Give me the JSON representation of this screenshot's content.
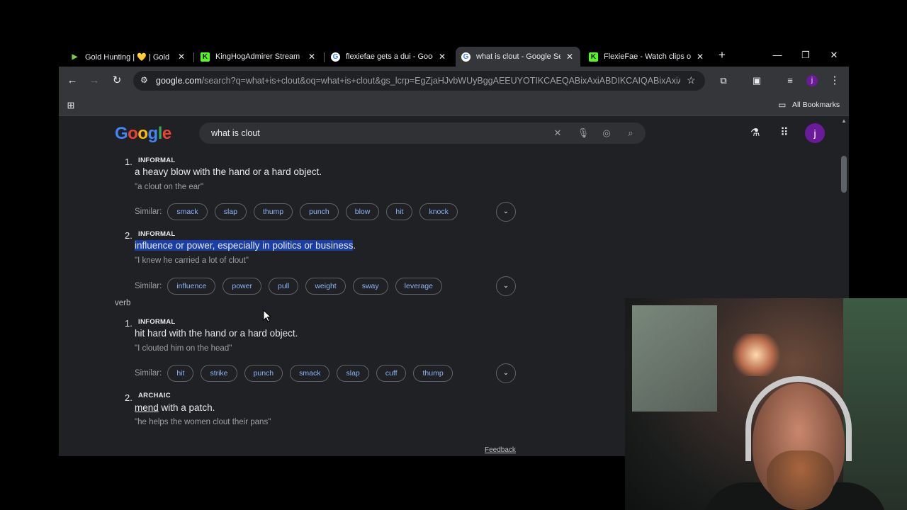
{
  "tabs": [
    {
      "title": "Gold Hunting | 💛 | Gold F",
      "favicon": "rumble-icon",
      "color": "#85c742"
    },
    {
      "title": "KingHogAdmirer Stream -",
      "favicon": "kick-icon",
      "color": "#53fc18"
    },
    {
      "title": "flexiefae gets a dui - Goog",
      "favicon": "google-icon",
      "color": "#ffffff"
    },
    {
      "title": "what is clout - Google Sea",
      "favicon": "google-icon",
      "color": "#ffffff"
    },
    {
      "title": "FlexieFae - Watch clips on",
      "favicon": "kick-icon",
      "color": "#53fc18"
    }
  ],
  "url": {
    "host": "google.com",
    "path": "/search?q=what+is+clout&oq=what+is+clout&gs_lcrp=EgZjaHJvbWUyBggAEEUYOTIKCAEQABixAxiABDIKCAIQABixAxiABDI..."
  },
  "bookmarks": {
    "all_label": "All Bookmarks"
  },
  "search": {
    "logo": "Google",
    "query": "what is clout",
    "avatar_letter": "j"
  },
  "definitions": {
    "noun": [
      {
        "num": "1.",
        "tag": "INFORMAL",
        "text": "a heavy blow with the hand or a hard object.",
        "example": "\"a clout on the ear\"",
        "similar_label": "Similar:",
        "similar": [
          "smack",
          "slap",
          "thump",
          "punch",
          "blow",
          "hit",
          "knock"
        ]
      },
      {
        "num": "2.",
        "tag": "INFORMAL",
        "text": "influence or power, especially in politics or business",
        "text_tail": ".",
        "example": "\"I knew he carried a lot of clout\"",
        "similar_label": "Similar:",
        "similar": [
          "influence",
          "power",
          "pull",
          "weight",
          "sway",
          "leverage"
        ]
      }
    ],
    "verb_label": "verb",
    "verb": [
      {
        "num": "1.",
        "tag": "INFORMAL",
        "text": "hit hard with the hand or a hard object.",
        "example": "\"I clouted him on the head\"",
        "similar_label": "Similar:",
        "similar": [
          "hit",
          "strike",
          "punch",
          "smack",
          "slap",
          "cuff",
          "thump"
        ]
      },
      {
        "num": "2.",
        "tag": "ARCHAIC",
        "link": "mend",
        "text": " with a patch.",
        "example": "\"he helps the women clout their pans\""
      }
    ]
  },
  "feedback": "Feedback",
  "colors": {
    "highlight": "#1a3ea8",
    "link": "#8ab4f8",
    "avatar": "#6a1b9a"
  }
}
